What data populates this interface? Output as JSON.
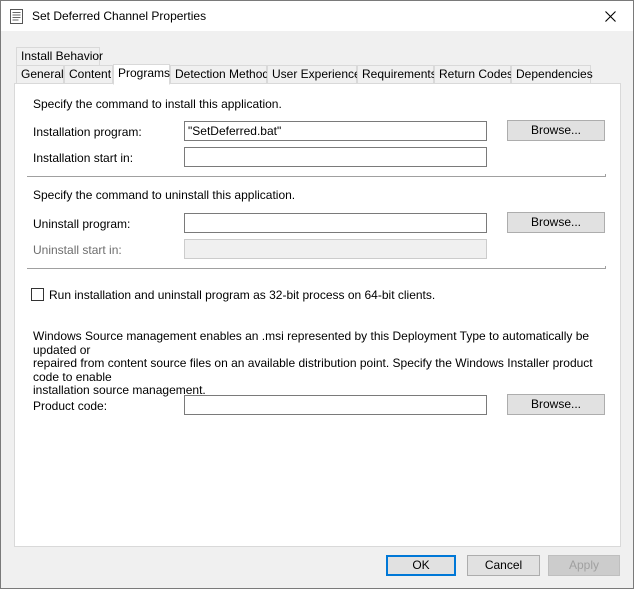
{
  "window": {
    "title": "Set Deferred Channel Properties"
  },
  "tabs_row1": [
    {
      "label": "Install Behavior"
    }
  ],
  "tabs_row2": [
    {
      "label": "General"
    },
    {
      "label": "Content"
    },
    {
      "label": "Programs",
      "active": true
    },
    {
      "label": "Detection Method"
    },
    {
      "label": "User Experience"
    },
    {
      "label": "Requirements"
    },
    {
      "label": "Return Codes"
    },
    {
      "label": "Dependencies"
    }
  ],
  "install": {
    "heading": "Specify the command to install this application.",
    "program_label": "Installation program:",
    "program_value": "\"SetDeferred.bat\"",
    "startin_label": "Installation start in:",
    "startin_value": "",
    "browse_label": "Browse..."
  },
  "uninstall": {
    "heading": "Specify the command to uninstall this application.",
    "program_label": "Uninstall program:",
    "program_value": "",
    "startin_label": "Uninstall start in:",
    "startin_value": "",
    "browse_label": "Browse..."
  },
  "run32bit": {
    "label": "Run installation and uninstall program as 32-bit process on 64-bit clients.",
    "checked": false
  },
  "source_mgmt": {
    "line1": "Windows Source management enables an .msi represented by this Deployment Type to automatically be updated or",
    "line2": "repaired from content source files on an available distribution point. Specify the Windows Installer product code to enable",
    "line3": "installation source management.",
    "product_code_label": "Product code:",
    "product_code_value": "",
    "browse_label": "Browse..."
  },
  "footer": {
    "ok": "OK",
    "cancel": "Cancel",
    "apply": "Apply"
  },
  "colors": {
    "accent": "#0078d7",
    "checkbox_border": "#333333"
  }
}
